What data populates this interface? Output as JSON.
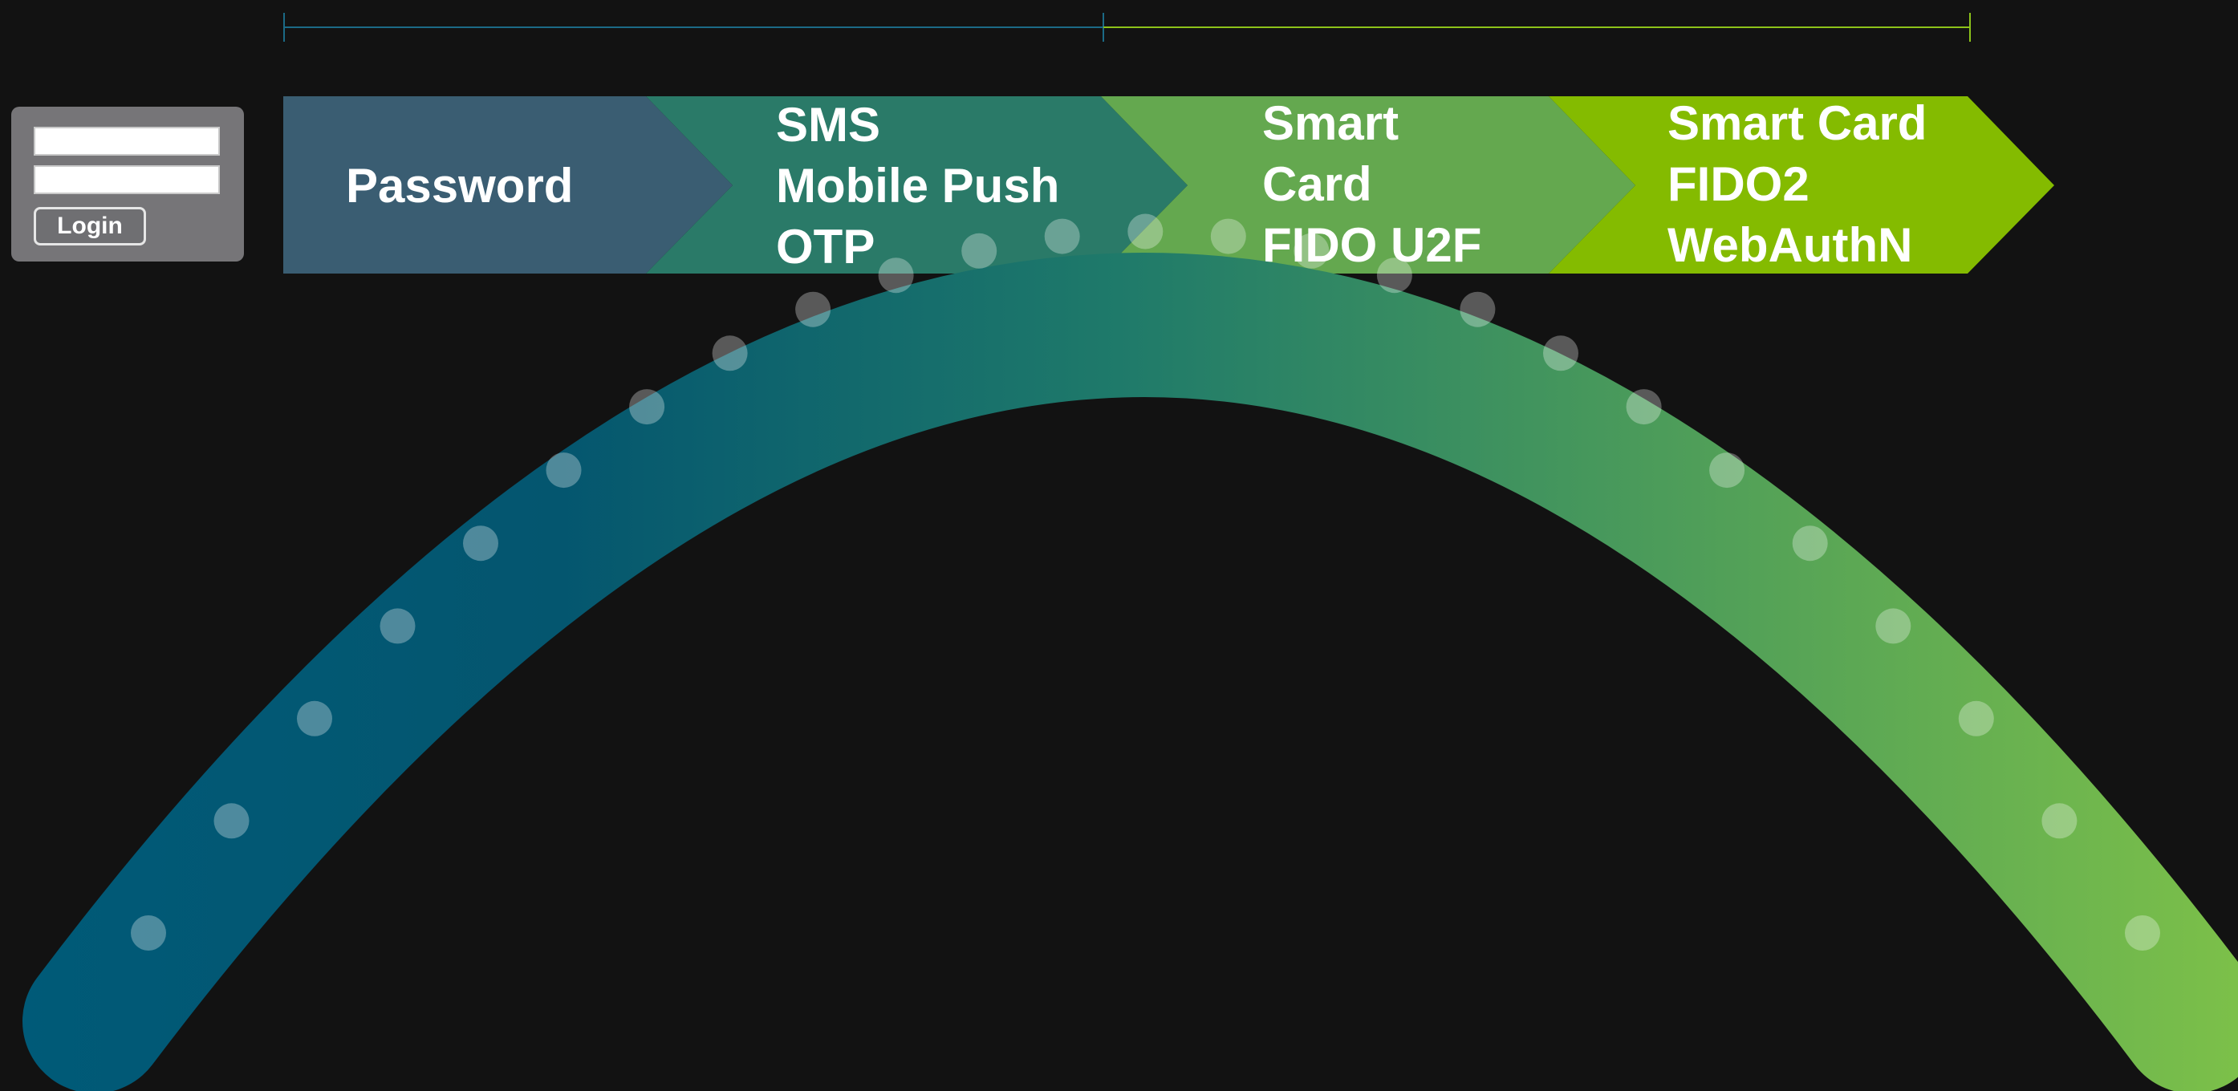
{
  "login": {
    "button_label": "Login"
  },
  "stages": [
    {
      "lines": [
        "Password"
      ],
      "color": "#3a5d72"
    },
    {
      "lines": [
        "SMS",
        "Mobile Push",
        "OTP"
      ],
      "color": "#2a7a68"
    },
    {
      "lines": [
        "Smart",
        "Card",
        "FIDO U2F"
      ],
      "color": "#64a84f"
    },
    {
      "lines": [
        "Smart Card",
        "FIDO2",
        "WebAuthN"
      ],
      "color": "#84bb00"
    }
  ],
  "timeline": {
    "left_color": "#1b6a86",
    "right_color": "#8cc21a"
  },
  "arc": {
    "start_color": "#005a78",
    "end_color": "#7cc049",
    "dot_color": "#ffffff",
    "dot_count": 25
  }
}
